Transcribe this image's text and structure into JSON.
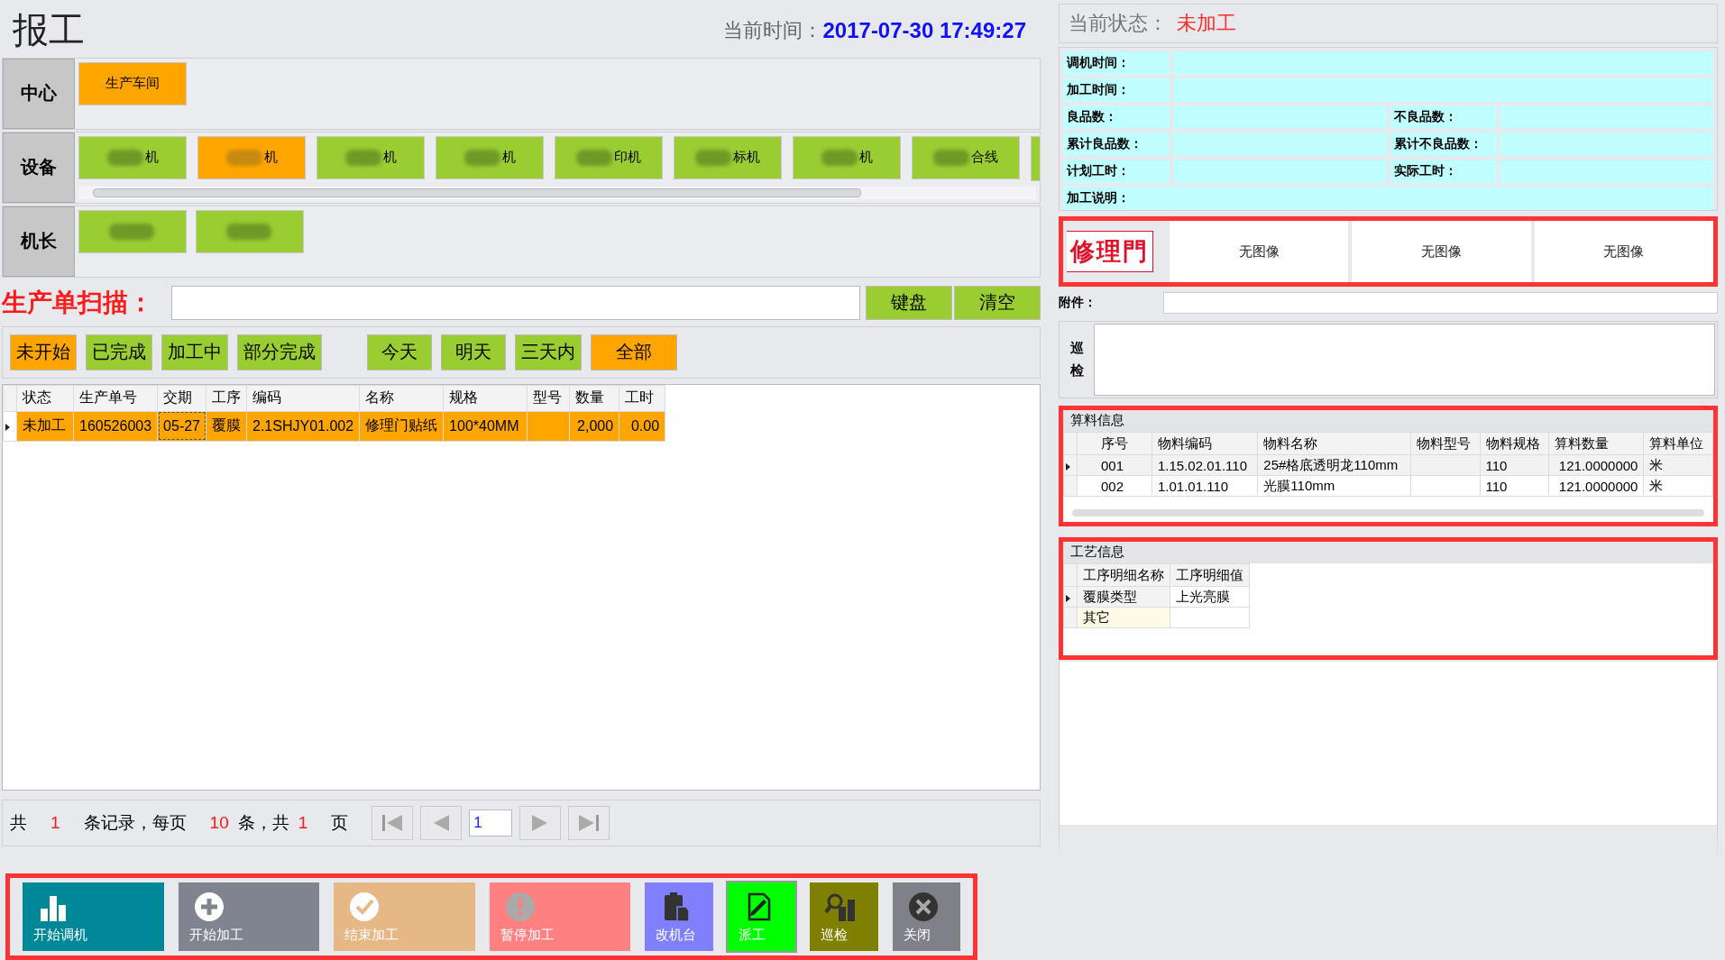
{
  "title": "报工",
  "clock": {
    "label": "当前时间：",
    "value": "2017-07-30 17:49:27"
  },
  "center": {
    "label": "中心",
    "items": [
      {
        "label": "生产车间",
        "selected": true
      }
    ]
  },
  "devices": {
    "label": "设备",
    "items": [
      {
        "label": "机",
        "selected": false,
        "redacted": true
      },
      {
        "label": "机",
        "selected": true,
        "redacted": true
      },
      {
        "label": "机",
        "selected": false,
        "redacted": true
      },
      {
        "label": "机",
        "selected": false,
        "redacted": true
      },
      {
        "label": "印机",
        "selected": false,
        "redacted": true
      },
      {
        "label": "标机",
        "selected": false,
        "redacted": true
      },
      {
        "label": "机",
        "selected": false,
        "redacted": true
      },
      {
        "label": "合线",
        "selected": false,
        "redacted": true
      }
    ]
  },
  "operators": {
    "label": "机长",
    "items": [
      {
        "selected": false,
        "redacted": true
      },
      {
        "selected": false,
        "redacted": true
      }
    ]
  },
  "scan": {
    "label": "生产单扫描：",
    "buttons": [
      "键盘",
      "清空"
    ]
  },
  "status_filters": [
    {
      "label": "未开始",
      "selected": true
    },
    {
      "label": "已完成",
      "selected": false
    },
    {
      "label": "加工中",
      "selected": false
    },
    {
      "label": "部分完成",
      "selected": false
    }
  ],
  "date_filters": [
    {
      "label": "今天",
      "selected": false
    },
    {
      "label": "明天",
      "selected": false
    },
    {
      "label": "三天内",
      "selected": false
    },
    {
      "label": "全部",
      "selected": true
    }
  ],
  "table": {
    "columns": [
      "状态",
      "生产单号",
      "交期",
      "工序",
      "编码",
      "名称",
      "规格",
      "型号",
      "数量",
      "工时"
    ],
    "rows": [
      {
        "selected": true,
        "cells": [
          "未加工",
          "160526003",
          "05-27",
          "覆膜",
          "2.1SHJY01.002",
          "修理门贴纸",
          "100*40MM",
          "",
          "2,000",
          "0.00"
        ]
      }
    ]
  },
  "pagination": {
    "t1": "共",
    "total": "1",
    "t2": "条记录，每页",
    "per_page": "10",
    "t3": "条，共",
    "pages": "1",
    "t4": "页",
    "page": "1"
  },
  "toolbar": [
    {
      "label": "开始调机",
      "kind": "chart",
      "color": "#008899",
      "selected": false
    },
    {
      "label": "开始加工",
      "kind": "plus",
      "color": "#808390",
      "selected": false
    },
    {
      "label": "结束加工",
      "kind": "check",
      "color": "#e6b886",
      "selected": false
    },
    {
      "label": "暂停加工",
      "kind": "alert",
      "color": "#ff8080",
      "selected": false
    },
    {
      "label": "改机台",
      "kind": "clipboard",
      "color": "#8080ff",
      "selected": false
    },
    {
      "label": "派工",
      "kind": "edit",
      "color": "#00ff00",
      "selected": true
    },
    {
      "label": "巡检",
      "kind": "inspect",
      "color": "#808000",
      "selected": false
    },
    {
      "label": "关闭",
      "kind": "close",
      "color": "#808088",
      "selected": false
    }
  ],
  "status": {
    "label": "当前状态：",
    "value": "未加工"
  },
  "info": [
    [
      {
        "label": "调机时间："
      }
    ],
    [
      {
        "label": "加工时间："
      }
    ],
    [
      {
        "label": "良品数："
      },
      {
        "label": "不良品数："
      }
    ],
    [
      {
        "label": "累计良品数："
      },
      {
        "label": "累计不良品数："
      }
    ],
    [
      {
        "label": "计划工时："
      },
      {
        "label": "实际工时："
      }
    ],
    [
      {
        "label": "加工说明："
      }
    ]
  ],
  "images": {
    "logo": "修理門",
    "placeholders": [
      "无图像",
      "无图像",
      "无图像"
    ]
  },
  "attachment": {
    "label": "附件："
  },
  "inspection": {
    "label": "巡检"
  },
  "materials": {
    "title": "算料信息",
    "columns": [
      "序号",
      "物料编码",
      "物料名称",
      "物料型号",
      "物料规格",
      "算料数量",
      "算料单位"
    ],
    "rows": [
      {
        "selected": true,
        "cells": [
          "001",
          "1.15.02.01.110",
          "25#格底透明龙110mm",
          "",
          "110",
          "121.0000000",
          "米"
        ]
      },
      {
        "selected": false,
        "cells": [
          "002",
          "1.01.01.110",
          "光膜110mm",
          "",
          "110",
          "121.0000000",
          "米"
        ]
      }
    ]
  },
  "process": {
    "title": "工艺信息",
    "columns": [
      "工序明细名称",
      "工序明细值"
    ],
    "rows": [
      {
        "selected": true,
        "cells": [
          "覆膜类型",
          "上光亮膜"
        ]
      },
      {
        "selected": false,
        "cells": [
          "其它",
          ""
        ]
      }
    ]
  }
}
